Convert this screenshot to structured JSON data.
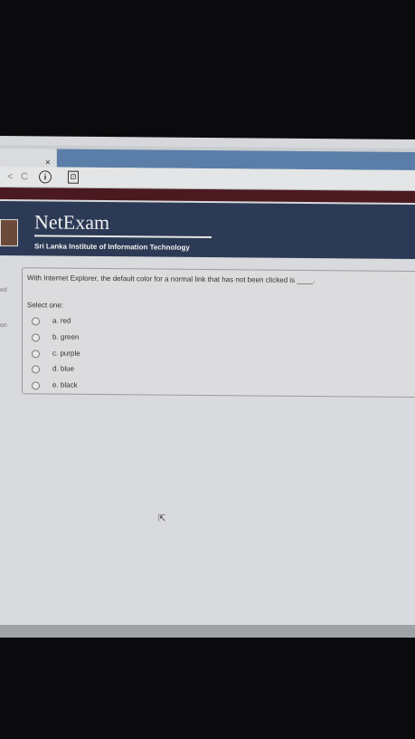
{
  "browser": {
    "tab_close": "×",
    "nav_back": "<",
    "nav_refresh": "C",
    "info": "i",
    "page_icon": "⊡"
  },
  "header": {
    "title": "NetExam",
    "subtitle": "Sri Lanka Institute of Information Technology"
  },
  "side": {
    "top_fragment": "ed",
    "bottom_fragment": "on"
  },
  "quiz": {
    "question": "With Internet Explorer, the default color for a normal link that has not been clicked is ____.",
    "select_label": "Select one:",
    "options": [
      {
        "label": "a. red"
      },
      {
        "label": "b. green"
      },
      {
        "label": "c. purple"
      },
      {
        "label": "d. blue"
      },
      {
        "label": "e. black"
      }
    ]
  },
  "cursor": "⇱"
}
